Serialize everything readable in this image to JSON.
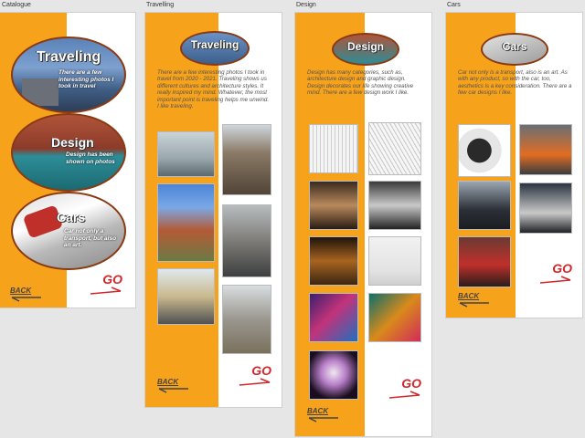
{
  "frames": {
    "catalogue": {
      "label": "Catalogue",
      "cards": [
        {
          "title": "Traveling",
          "desc": "There are a few interesting photos I took in travel"
        },
        {
          "title": "Design",
          "desc": "Design has been shown on photos"
        },
        {
          "title": "Cars",
          "desc": "Car not only a transport, but also an art."
        }
      ],
      "back_label": "BACK",
      "go_label": "GO"
    },
    "travelling": {
      "label": "Travelling",
      "title": "Traveling",
      "text": "There are a few interesting photos I took in travel from 2020 - 2021. Traveling shows us different cultures and architecture styles. It really inspired my mind. Whatever, the most important point is traveling helps me unwind. I like traveling.",
      "back_label": "BACK",
      "go_label": "GO"
    },
    "design": {
      "label": "Design",
      "title": "Design",
      "text": "Design has many categories, such as, architecture design and graphic design. Design decorates our life showing creative mind. There are a few design work I like.",
      "back_label": "BACK",
      "go_label": "GO"
    },
    "cars": {
      "label": "Cars",
      "title": "Cars",
      "text": "Car not only is a transport, also is an art. As with any product, so with the car, too, aesthetics is a key consideration. There are a few car designs I like.",
      "back_label": "BACK",
      "go_label": "GO"
    }
  },
  "colors": {
    "accent": "#f7a21b",
    "go": "#d1272b",
    "canvas": "#e6e6e6"
  }
}
